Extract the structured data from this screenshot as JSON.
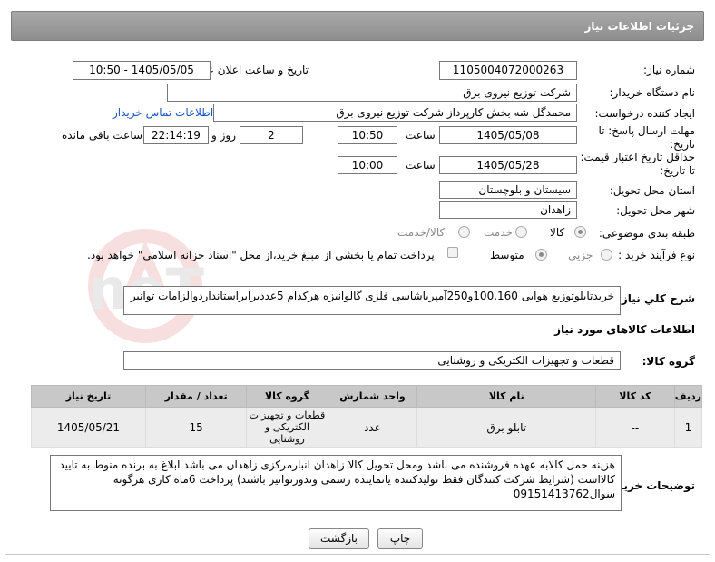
{
  "header": {
    "title": "جزئیات اطلاعات نیاز"
  },
  "form": {
    "need_number_label": "شماره نیاز:",
    "need_number": "1105004072000263",
    "announce_label": "تاریخ و ساعت اعلان عمومی:",
    "announce_value": "1405/05/05 - 10:50",
    "buyer_org_label": "نام دستگاه خریدار:",
    "buyer_org": "شرکت توزیع نیروی برق",
    "creator_label": "ایجاد کننده درخواست:",
    "creator": "محمدگل شه بخش کارپرداز شرکت توزیع نیروی برق",
    "contact_link": "اطلاعات تماس خریدار",
    "deadline_label": "مهلت ارسال پاسخ: تا تاریخ:",
    "deadline_date": "1405/05/08",
    "time_label": "ساعت",
    "deadline_time": "10:50",
    "days": "2",
    "days_label": "روز و",
    "remaining": "22:14:19",
    "remaining_label": "ساعت باقی مانده",
    "validity_label": "حداقل تاریخ اعتبار قیمت: تا تاریخ:",
    "validity_date": "1405/05/28",
    "validity_time": "10:00",
    "province_label": "استان محل تحویل:",
    "province": "سیستان و بلوچستان",
    "city_label": "شهر محل تحویل:",
    "city": "زاهدان",
    "category_label": "طبقه بندی موضوعی:",
    "cat_options": [
      "کالا",
      "خدمت",
      "کالا/خدمت"
    ],
    "purchase_label": "نوع فرآیند خرید :",
    "purchase_options": [
      "جزیی",
      "متوسط"
    ],
    "payment_note": "پرداخت تمام یا بخشی از مبلغ خرید،از محل \"اسناد خزانه اسلامی\" خواهد بود."
  },
  "summary": {
    "label": "شرح کلي نياز:",
    "text": "خریدتابلوتوزیع  هوایی 100.160و250آمپرباشاسی فلزی گالوانیزه هرکدام 5عددبرابراستانداردوالزامات توانیر"
  },
  "goods": {
    "section_title": "اطلاعات کالاهای مورد نیاز",
    "group_label": "گروه کالا:",
    "group_value": "قطعات و تجهیزات الکتریکی و روشنایی",
    "columns": [
      "ردیف",
      "کد کالا",
      "نام کالا",
      "واحد شمارش",
      "گروه کالا",
      "تعداد / مقدار",
      "تاریخ نیاز"
    ],
    "rows": [
      {
        "index": "1",
        "code": "--",
        "name": "تابلو برق",
        "unit": "عدد",
        "group": "قطعات و تجهیزات الکتریکی و روشنایی",
        "qty": "15",
        "date": "1405/05/21"
      }
    ]
  },
  "buyer_notes": {
    "label": "توضیحات خریدار:",
    "text": "هزینه حمل کالابه عهده فروشنده می باشد ومحل تحویل کالا زاهدان انبارمرکزی زاهدان می باشد  ابلاغ به برنده منوط به تایید کالااست (شرایط شرکت کنندگان فقط تولیدکننده   یانماینده رسمی وندورتوانیر باشند) پرداخت 6ماه کاری هرگونه سوال09151413762"
  },
  "buttons": {
    "print": "چاپ",
    "back": "بازگشت"
  },
  "watermark": "AriaTender.neT"
}
